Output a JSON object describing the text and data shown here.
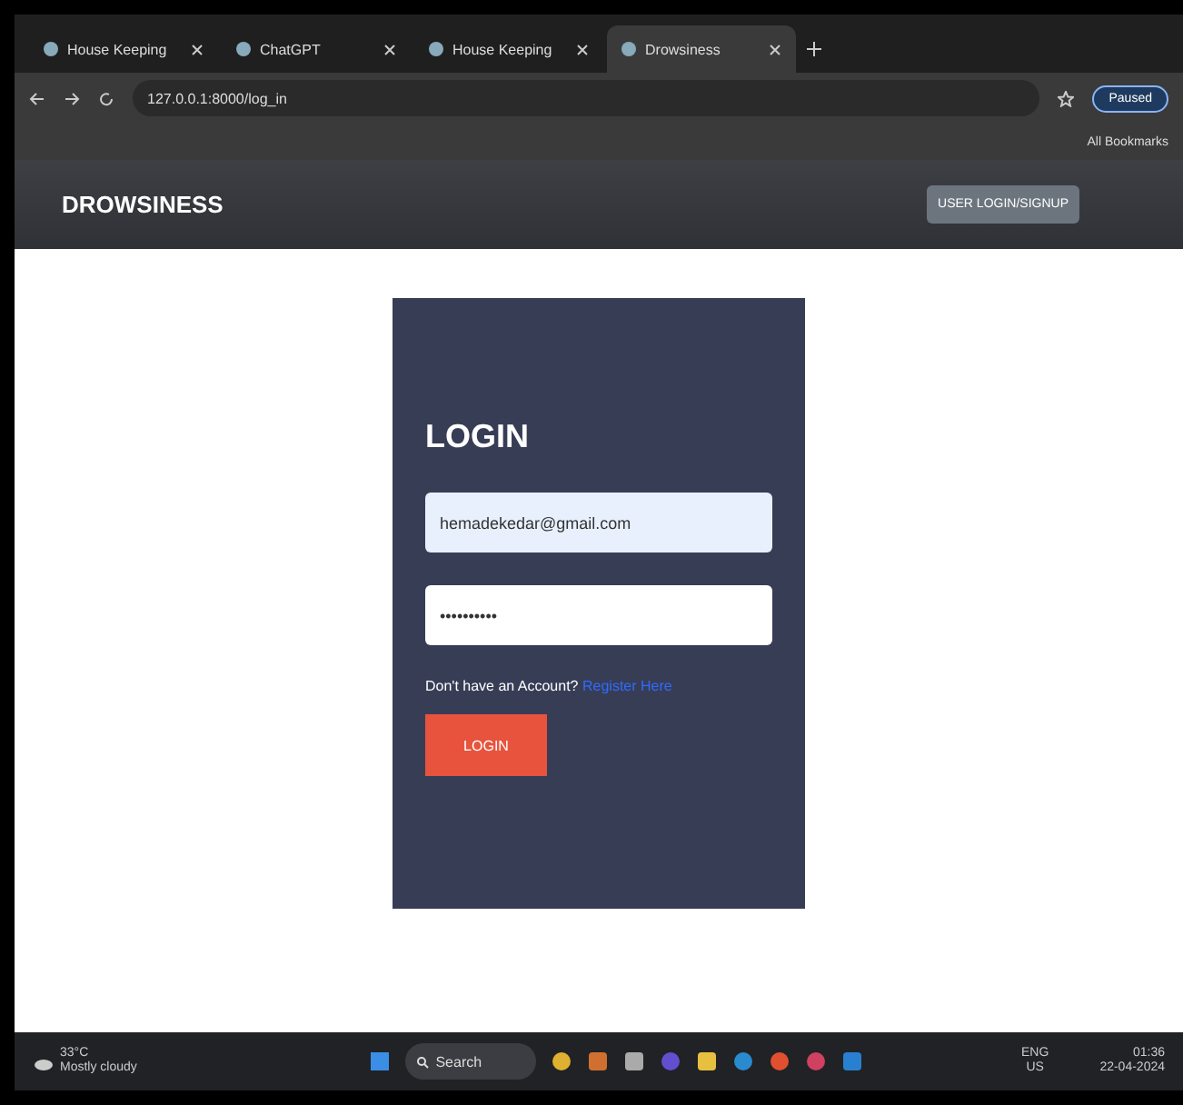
{
  "browser": {
    "tabs": [
      {
        "title": "House Keeping",
        "selected": false
      },
      {
        "title": "ChatGPT",
        "selected": false
      },
      {
        "title": "House Keeping",
        "selected": false
      },
      {
        "title": "Drowsiness",
        "selected": true
      }
    ],
    "url": "127.0.0.1:8000/log_in",
    "profile": "Paused",
    "bookmarks": "All Bookmarks"
  },
  "navbar": {
    "brand": "DROWSINESS",
    "menu": "USER LOGIN/SIGNUP"
  },
  "login": {
    "title": "LOGIN",
    "email": {
      "value": "hemadekedar@gmail.com"
    },
    "password": {
      "value": "••••••••••"
    },
    "prompt": "Don't have an Account?",
    "register_link": "Register Here",
    "button": "LOGIN"
  },
  "taskbar": {
    "temperature": "33°C",
    "weather": "Mostly cloudy",
    "search": "Search",
    "language": "ENG",
    "region": "US",
    "time": "01:36",
    "date": "22-04-2024"
  }
}
